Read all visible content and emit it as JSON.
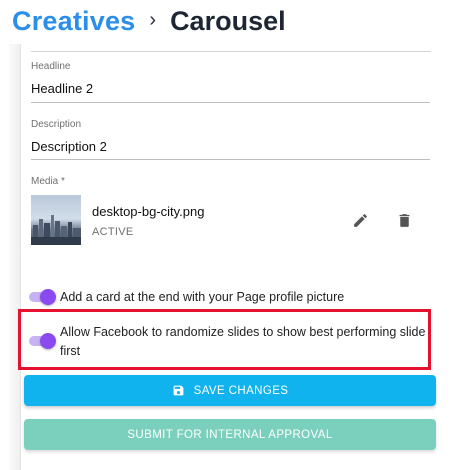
{
  "breadcrumb": {
    "root": "Creatives",
    "separator": "›",
    "current": "Carousel"
  },
  "form": {
    "headline": {
      "label": "Headline",
      "value": "Headline 2"
    },
    "description": {
      "label": "Description",
      "value": "Description 2"
    },
    "media": {
      "label": "Media *",
      "file_name": "desktop-bg-city.png",
      "status": "ACTIVE",
      "actions": [
        "pencil-icon",
        "trash-icon"
      ]
    }
  },
  "toggles": [
    {
      "label": "Add a card at the end with your Page profile picture",
      "on": true
    },
    {
      "label": "Allow Facebook to randomize slides to show best performing slide first",
      "on": true
    }
  ],
  "buttons": {
    "save": {
      "label": "SAVE CHANGES",
      "icon": "floppy-disk-icon"
    },
    "submit": {
      "label": "SUBMIT FOR INTERNAL APPROVAL"
    }
  },
  "colors": {
    "brand_blue": "#2b8ee8",
    "toggle_on": "#8a4af0",
    "save_button": "#10b3ee",
    "submit_button": "#7bd0bd",
    "highlight": "#e5122f"
  }
}
